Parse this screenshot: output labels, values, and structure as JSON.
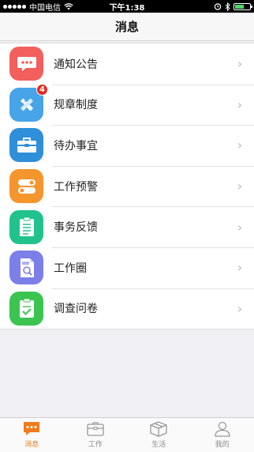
{
  "status_bar": {
    "carrier": "中国电信",
    "time": "下午1:38"
  },
  "header": {
    "title": "消息"
  },
  "menu": {
    "items": [
      {
        "label": "通知公告",
        "icon": "chat-bubble-icon",
        "color": "#f25f5c",
        "badge": ""
      },
      {
        "label": "规章制度",
        "icon": "pencil-ruler-icon",
        "color": "#48a4e8",
        "badge": "4"
      },
      {
        "label": "待办事宜",
        "icon": "toolbox-icon",
        "color": "#2f8fd9",
        "badge": ""
      },
      {
        "label": "工作预警",
        "icon": "toggle-icon",
        "color": "#f5952d",
        "badge": ""
      },
      {
        "label": "事务反馈",
        "icon": "clipboard-icon",
        "color": "#22c28d",
        "badge": ""
      },
      {
        "label": "工作圈",
        "icon": "jobs-search-icon",
        "color": "#7c7fe8",
        "badge": ""
      },
      {
        "label": "调查问卷",
        "icon": "checklist-icon",
        "color": "#3cc451",
        "badge": ""
      }
    ],
    "chevron": "›"
  },
  "tab_bar": {
    "tabs": [
      {
        "label": "消息",
        "icon": "message-icon",
        "active": true
      },
      {
        "label": "工作",
        "icon": "briefcase-icon",
        "active": false
      },
      {
        "label": "生活",
        "icon": "box-icon",
        "active": false
      },
      {
        "label": "我的",
        "icon": "person-icon",
        "active": false
      }
    ],
    "active_color": "#f07b1d",
    "inactive_color": "#888888"
  }
}
